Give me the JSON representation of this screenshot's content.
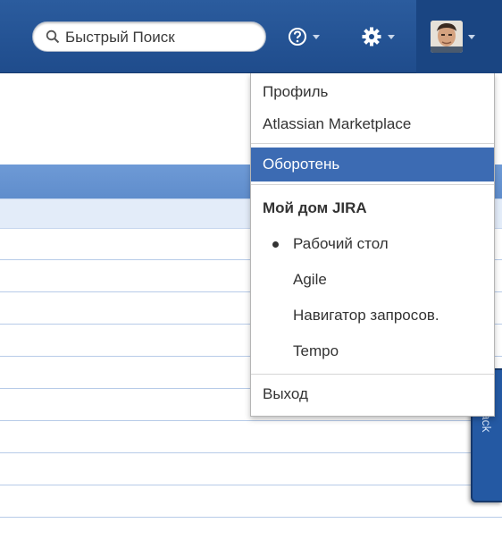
{
  "header": {
    "search_placeholder": "Быстрый Поиск"
  },
  "user_menu": {
    "items": [
      {
        "label": "Профиль"
      },
      {
        "label": "Atlassian Marketplace"
      },
      {
        "label": "Оборотень",
        "active": true
      }
    ],
    "section_heading": "Мой дом JIRA",
    "home_options": [
      {
        "label": "Рабочий стол",
        "selected": true
      },
      {
        "label": "Agile"
      },
      {
        "label": "Навигатор запросов."
      },
      {
        "label": "Tempo"
      }
    ],
    "logout": "Выход"
  },
  "feedback": {
    "label": "Feedback"
  },
  "colors": {
    "header_bg": "#1f4c8c",
    "menu_active": "#3c6bb3",
    "feedback_tab": "#2459a3"
  },
  "icons": [
    "search-icon",
    "help-icon",
    "gear-icon",
    "avatar",
    "chevron-down-icon"
  ]
}
